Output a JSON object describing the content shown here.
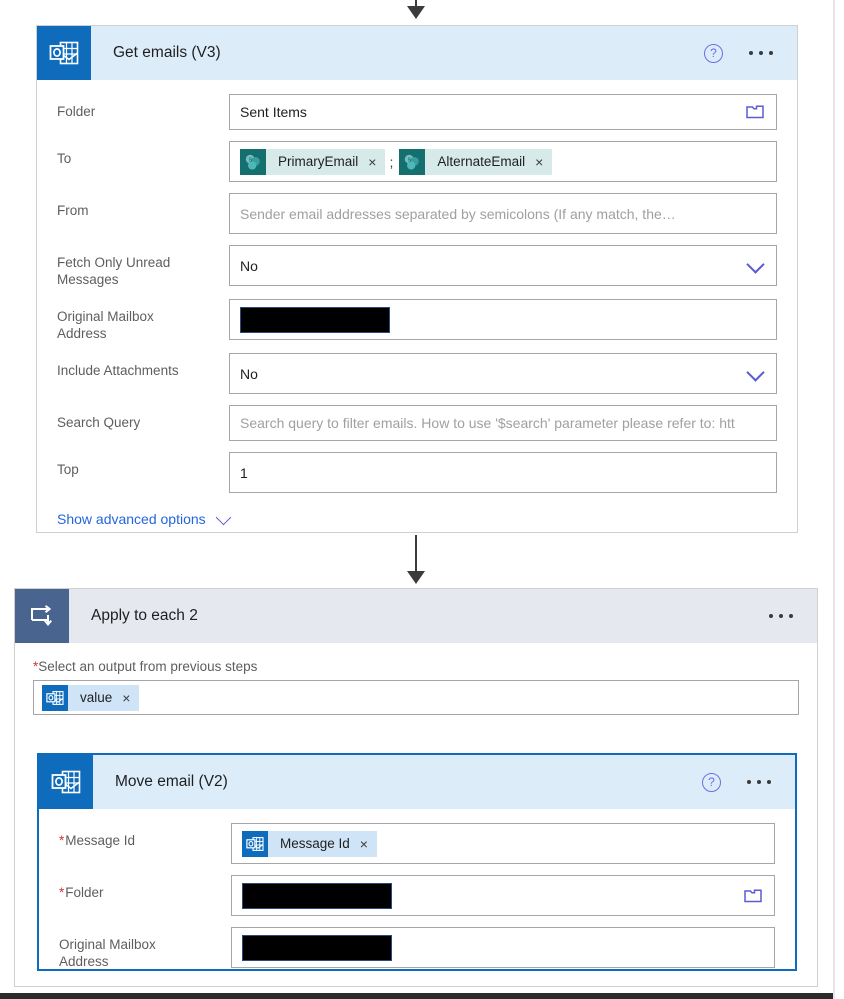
{
  "flow": {
    "cards": [
      {
        "id": "get-emails",
        "title": "Get emails (V3)",
        "icon": "outlook-icon",
        "help_icon": "help-icon",
        "menu_icon": "ellipsis-icon",
        "advanced_link": "Show advanced options",
        "advanced_chevron": "chevron-down-icon",
        "fields": [
          {
            "label": "Folder",
            "required": false,
            "type": "text-with-picker",
            "value": "Sent Items",
            "picker_icon": "folder-icon"
          },
          {
            "label": "To",
            "required": false,
            "type": "tokens",
            "tokens": [
              {
                "text": "PrimaryEmail",
                "icon": "sharepoint-icon",
                "remove_label": "×"
              },
              {
                "text": "AlternateEmail",
                "icon": "sharepoint-icon",
                "remove_label": "×"
              }
            ],
            "separator": ";"
          },
          {
            "label": "From",
            "required": false,
            "type": "text",
            "value": "",
            "placeholder": "Sender email addresses separated by semicolons (If any match, the…"
          },
          {
            "label": "Fetch Only Unread\nMessages",
            "required": false,
            "type": "dropdown",
            "value": "No",
            "chevron_icon": "chevron-down-icon"
          },
          {
            "label": "Original Mailbox\nAddress",
            "required": false,
            "type": "redacted",
            "value": ""
          },
          {
            "label": "Include Attachments",
            "required": false,
            "type": "dropdown",
            "value": "No",
            "chevron_icon": "chevron-down-icon"
          },
          {
            "label": "Search Query",
            "required": false,
            "type": "text",
            "value": "",
            "placeholder": "Search query to filter emails. How to use '$search' parameter please refer to: htt"
          },
          {
            "label": "Top",
            "required": false,
            "type": "text",
            "value": "1",
            "placeholder": ""
          }
        ]
      },
      {
        "id": "apply-to-each-2",
        "title": "Apply to each 2",
        "icon": "loop-icon",
        "menu_icon": "ellipsis-icon",
        "select_label": "Select an output from previous steps",
        "select_required": true,
        "select_tokens": [
          {
            "text": "value",
            "icon": "outlook-icon",
            "remove_label": "×"
          }
        ]
      },
      {
        "id": "move-email",
        "title": "Move email (V2)",
        "icon": "outlook-icon",
        "help_icon": "help-icon",
        "menu_icon": "ellipsis-icon",
        "selected": true,
        "fields": [
          {
            "label": "Message Id",
            "required": true,
            "type": "tokens",
            "tokens": [
              {
                "text": "Message Id",
                "icon": "outlook-icon",
                "remove_label": "×"
              }
            ]
          },
          {
            "label": "Folder",
            "required": true,
            "type": "redacted-with-picker",
            "value": "",
            "picker_icon": "folder-icon"
          },
          {
            "label": "Original Mailbox\nAddress",
            "required": false,
            "type": "redacted",
            "value": ""
          }
        ]
      }
    ],
    "connectors": [
      {
        "name": "connector-top"
      },
      {
        "name": "connector-get-emails-to-loop"
      }
    ]
  },
  "colors": {
    "outlook_blue": "#0f6cbd",
    "loop_slate": "#4a6490",
    "header_blue": "#ddecf9",
    "header_gray": "#e5e9ef",
    "token_blue": "#cfe4f7",
    "token_teal": "#d6eaea",
    "sharepoint_teal": "#166f6f",
    "link_blue": "#2266dd",
    "required_red": "#d13438",
    "chevron_purple": "#5b5bd6",
    "redacted_black": "#000000"
  }
}
